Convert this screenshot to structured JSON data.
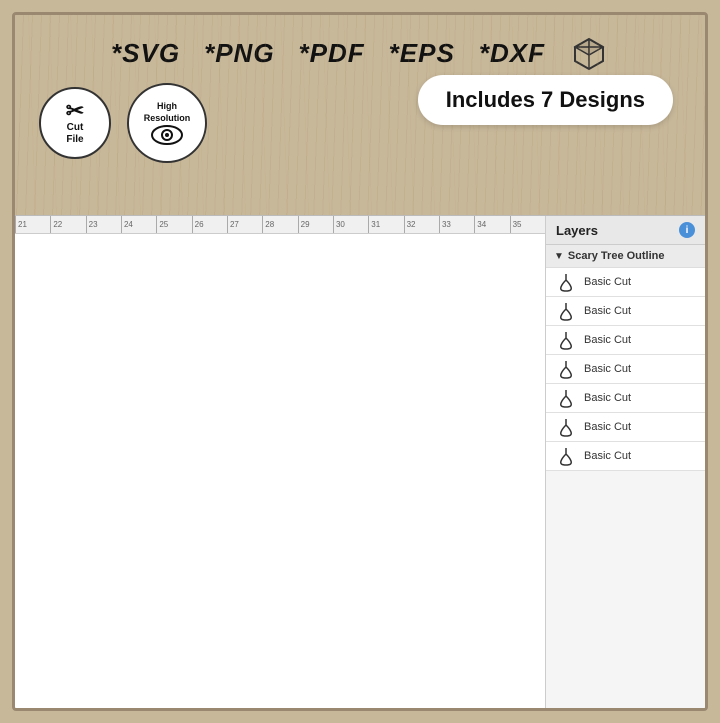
{
  "banner": {
    "file_types": [
      "*SVG",
      "*PNG",
      "*PDF",
      "*EPS",
      "*DXF"
    ],
    "includes_label": "Includes 7 Designs",
    "badges": [
      {
        "label": "Cut\nFile",
        "type": "scissors"
      },
      {
        "label": "High\nResolution",
        "type": "eye"
      }
    ]
  },
  "ruler": {
    "marks": [
      "21",
      "22",
      "23",
      "24",
      "25",
      "26",
      "27",
      "28",
      "29",
      "30",
      "31",
      "32",
      "33",
      "34",
      "35"
    ]
  },
  "layers": {
    "title": "Layers",
    "group_name": "Scary Tree Outline",
    "items": [
      {
        "label": "Basic Cut"
      },
      {
        "label": "Basic Cut"
      },
      {
        "label": "Basic Cut"
      },
      {
        "label": "Basic Cut"
      },
      {
        "label": "Basic Cut"
      },
      {
        "label": "Basic Cut"
      },
      {
        "label": "Basic Cut"
      }
    ]
  }
}
